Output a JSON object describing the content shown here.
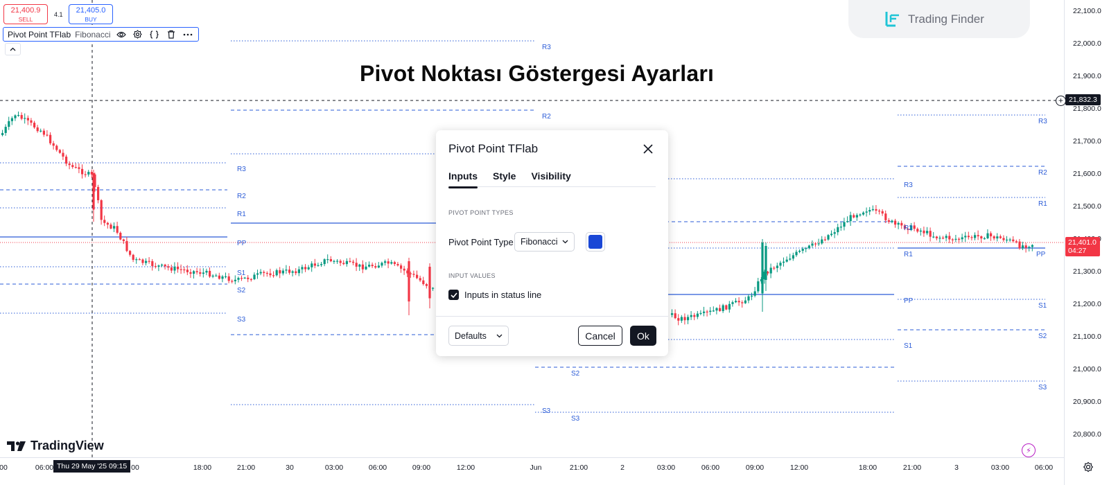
{
  "trade": {
    "sell_price": "21,400.9",
    "sell_label": "SELL",
    "spread": "4.1",
    "buy_price": "21,405.0",
    "buy_label": "BUY"
  },
  "legend": {
    "indicator": "Pivot Point TFlab",
    "value": "Fibonacci"
  },
  "headline": "Pivot Noktası Göstergesi Ayarları",
  "watermark": "Trading Finder",
  "tv_logo": "TradingView",
  "price_axis": {
    "ticks": [
      "22,100.0",
      "22,000.0",
      "21,900.0",
      "21,800.0",
      "21,700.0",
      "21,600.0",
      "21,500.0",
      "21,400.0",
      "21,300.0",
      "21,200.0",
      "21,100.0",
      "21,000.0",
      "20,900.0",
      "20,800.0"
    ],
    "crosshair_price": "21,832.3",
    "last_price": "21,401.0",
    "countdown": "04:27"
  },
  "time_axis": {
    "ticks": [
      "00",
      "06:00",
      "00",
      "18:00",
      "21:00",
      "30",
      "03:00",
      "06:00",
      "09:00",
      "12:00",
      "Jun",
      "21:00",
      "2",
      "03:00",
      "06:00",
      "09:00",
      "12:00",
      "18:00",
      "21:00",
      "3",
      "03:00",
      "06:00"
    ],
    "crosshair_time": "Thu 29 May '25   09:15"
  },
  "pivot_labels": {
    "R3": "R3",
    "R2": "R2",
    "R1": "R1",
    "PP": "PP",
    "S1": "S1",
    "S2": "S2",
    "S3": "S3"
  },
  "dialog": {
    "title": "Pivot Point TFlab",
    "tabs": [
      "Inputs",
      "Style",
      "Visibility"
    ],
    "section_types": "PIVOT POINT TYPES",
    "type_label": "Pivot Point Type",
    "type_value": "Fibonacci",
    "line_color": "#1a47d6",
    "section_values": "INPUT VALUES",
    "checkbox_label": "Inputs in status line",
    "checkbox_checked": true,
    "defaults_label": "Defaults",
    "cancel_label": "Cancel",
    "ok_label": "Ok"
  },
  "colors": {
    "up": "#089981",
    "down": "#f23645",
    "pivot": "#2a5bd7"
  }
}
